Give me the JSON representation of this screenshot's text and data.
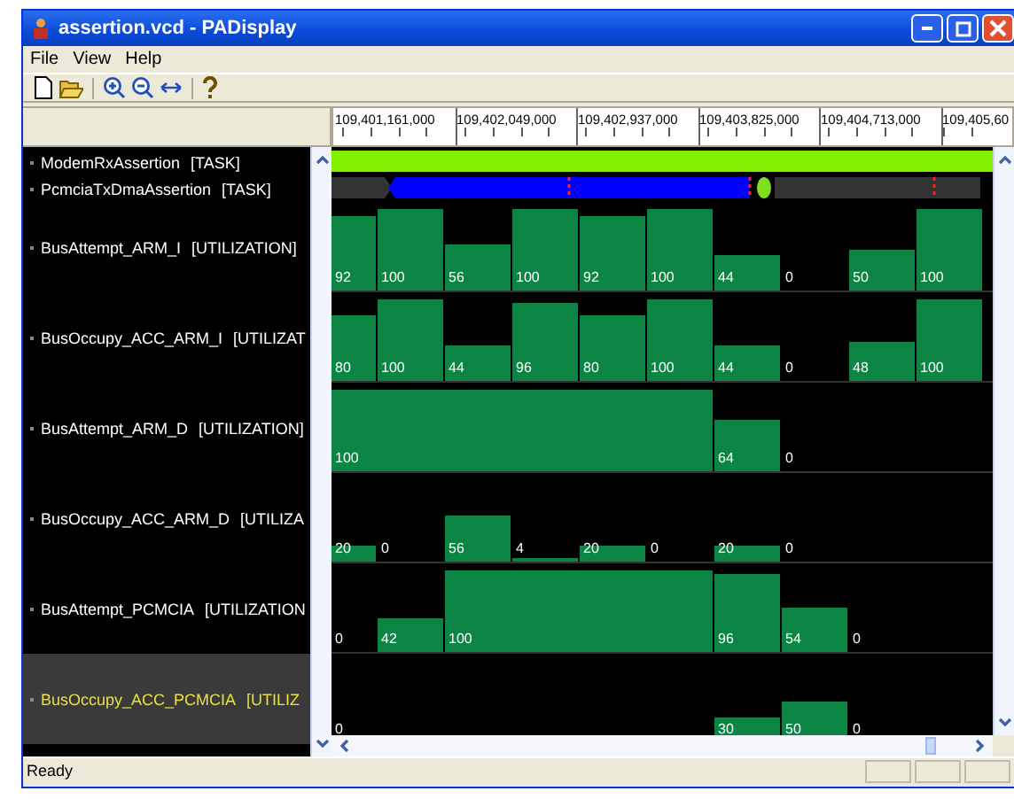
{
  "window": {
    "title": "assertion.vcd - PADisplay"
  },
  "menu": [
    "File",
    "View",
    "Help"
  ],
  "ruler": [
    "109,401,161,000",
    "109,402,049,000",
    "109,402,937,000",
    "109,403,825,000",
    "109,404,713,000",
    "109,405,60"
  ],
  "rows": [
    {
      "name": "ModemRxAssertion",
      "type": "[TASK]",
      "kind": "task",
      "selected": false
    },
    {
      "name": "PcmciaTxDmaAssertion",
      "type": "[TASK]",
      "kind": "task",
      "selected": false
    },
    {
      "name": "BusAttempt_ARM_I",
      "type": "[UTILIZATION]",
      "kind": "utilization",
      "selected": false,
      "slots": [
        {
          "kind": "bar",
          "label": "92"
        },
        {
          "kind": "bar",
          "label": "100"
        },
        {
          "kind": "bar",
          "label": "56"
        },
        {
          "kind": "bar",
          "label": "100"
        },
        {
          "kind": "bar",
          "label": "92"
        },
        {
          "kind": "bar",
          "label": "100"
        },
        {
          "kind": "bar",
          "label": "44"
        },
        {
          "kind": "bar",
          "label": "0"
        },
        {
          "kind": "bar",
          "label": "50"
        },
        {
          "kind": "bar",
          "label": "100"
        }
      ]
    },
    {
      "name": "BusOccupy_ACC_ARM_I",
      "type": "[UTILIZAT",
      "kind": "utilization",
      "selected": false,
      "slots": [
        {
          "kind": "bar",
          "label": "80"
        },
        {
          "kind": "bar",
          "label": "100"
        },
        {
          "kind": "bar",
          "label": "44"
        },
        {
          "kind": "bar",
          "label": "96"
        },
        {
          "kind": "bar",
          "label": "80"
        },
        {
          "kind": "bar",
          "label": "100"
        },
        {
          "kind": "bar",
          "label": "44"
        },
        {
          "kind": "bar",
          "label": "0"
        },
        {
          "kind": "bar",
          "label": "48"
        },
        {
          "kind": "bar",
          "label": "100"
        }
      ]
    },
    {
      "name": "BusAttempt_ARM_D",
      "type": "[UTILIZATION]",
      "kind": "utilization",
      "selected": false,
      "slots": [
        {
          "kind": "bar",
          "label": "100"
        },
        {
          "kind": "continued"
        },
        {
          "kind": "continued"
        },
        {
          "kind": "continued"
        },
        {
          "kind": "continued"
        },
        {
          "kind": "continued"
        },
        {
          "kind": "bar",
          "label": "64"
        },
        {
          "kind": "bar",
          "label": "0"
        }
      ]
    },
    {
      "name": "BusOccupy_ACC_ARM_D",
      "type": "[UTILIZA",
      "kind": "utilization",
      "selected": false,
      "slots": [
        {
          "kind": "bar",
          "label": "20"
        },
        {
          "kind": "bar",
          "label": "0"
        },
        {
          "kind": "bar",
          "label": "56"
        },
        {
          "kind": "bar",
          "label": "4"
        },
        {
          "kind": "bar",
          "label": "20"
        },
        {
          "kind": "bar",
          "label": "0"
        },
        {
          "kind": "bar",
          "label": "20"
        },
        {
          "kind": "bar",
          "label": "0"
        }
      ]
    },
    {
      "name": "BusAttempt_PCMCIA",
      "type": "[UTILIZATION",
      "kind": "utilization",
      "selected": false,
      "slots": [
        {
          "kind": "bar",
          "label": "0"
        },
        {
          "kind": "bar",
          "label": "42"
        },
        {
          "kind": "bar",
          "label": "100"
        },
        {
          "kind": "continued"
        },
        {
          "kind": "continued"
        },
        {
          "kind": "continued"
        },
        {
          "kind": "bar",
          "label": "96"
        },
        {
          "kind": "bar",
          "label": "54"
        },
        {
          "kind": "bar",
          "label": "0"
        }
      ]
    },
    {
      "name": "BusOccupy_ACC_PCMCIA",
      "type": "[UTILIZ",
      "kind": "utilization",
      "selected": true,
      "slots": [
        {
          "kind": "bar",
          "label": "0"
        },
        {
          "kind": "continued"
        },
        {
          "kind": "continued"
        },
        {
          "kind": "continued"
        },
        {
          "kind": "continued"
        },
        {
          "kind": "continued"
        },
        {
          "kind": "bar",
          "label": "30"
        },
        {
          "kind": "bar",
          "label": "50"
        },
        {
          "kind": "bar",
          "label": "0"
        }
      ]
    }
  ],
  "status_bar": {
    "text": "Ready"
  }
}
